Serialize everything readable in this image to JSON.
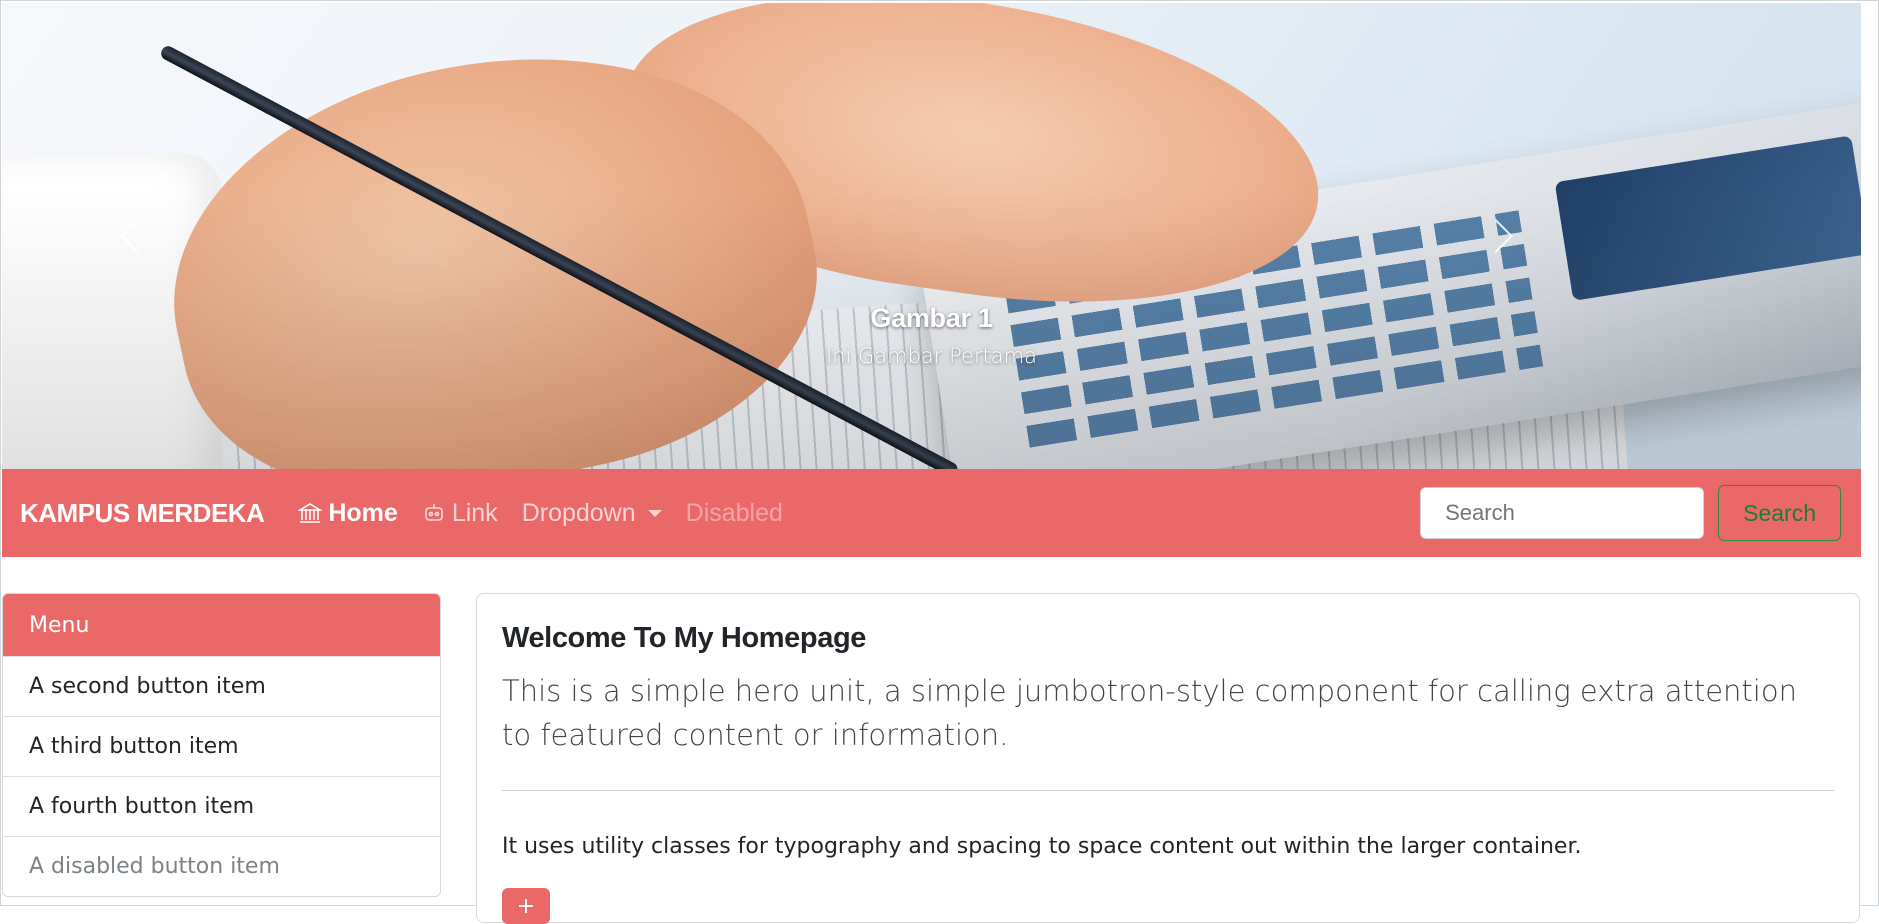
{
  "carousel": {
    "slide": {
      "title": "Gambar 1",
      "subtitle": "Ini Gambar Pertama"
    },
    "prev_icon": "chevron-left-icon",
    "next_icon": "chevron-right-icon"
  },
  "navbar": {
    "brand": "KAMPUS MERDEKA",
    "links": {
      "home": {
        "label": "Home",
        "icon": "bank-icon"
      },
      "link": {
        "label": "Link",
        "icon": "robot-icon"
      },
      "dropdown": {
        "label": "Dropdown"
      },
      "disabled": {
        "label": "Disabled"
      }
    },
    "search": {
      "placeholder": "Search",
      "button": "Search"
    },
    "color": "#ea6868"
  },
  "sidebar": {
    "items": [
      {
        "label": "Menu"
      },
      {
        "label": "A second button item"
      },
      {
        "label": "A third button item"
      },
      {
        "label": "A fourth button item"
      },
      {
        "label": "A disabled button item"
      }
    ]
  },
  "jumbotron": {
    "title": "Welcome To My Homepage",
    "lead": "This is a simple hero unit, a simple jumbotron-style component for calling extra attention to featured content or information.",
    "body": "It uses utility classes for typography and spacing to space content out within the larger container.",
    "button_icon": "plus-icon"
  }
}
